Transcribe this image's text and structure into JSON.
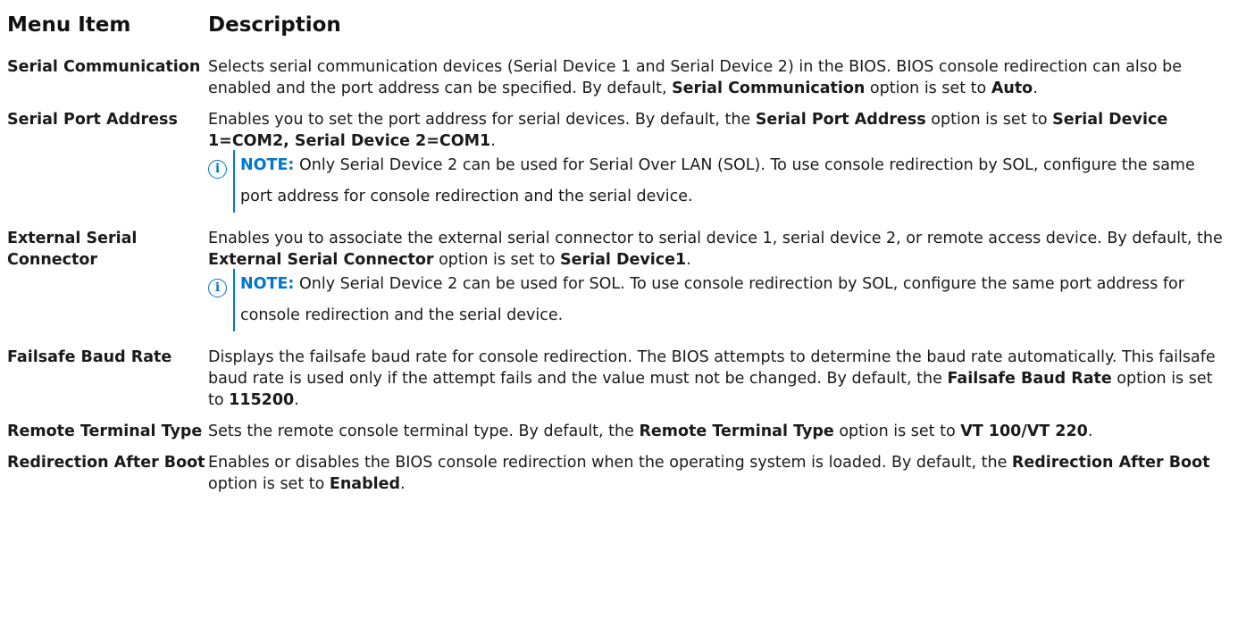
{
  "headers": {
    "item": "Menu Item",
    "description": "Description"
  },
  "rows": [
    {
      "item": "Serial Communication",
      "desc": [
        {
          "t": "Selects serial communication devices (Serial Device 1 and Serial Device 2) in the BIOS. BIOS console redirection can also be enabled and the port address can be specified. By default, "
        },
        {
          "t": "Serial Communication",
          "b": true
        },
        {
          "t": " option is set to "
        },
        {
          "t": "Auto",
          "b": true
        },
        {
          "t": "."
        }
      ]
    },
    {
      "item": "Serial Port Address",
      "desc": [
        {
          "t": "Enables you to set the port address for serial devices. By default, the "
        },
        {
          "t": "Serial Port Address",
          "b": true
        },
        {
          "t": " option is set to "
        },
        {
          "t": "Serial Device 1=COM2, Serial Device 2=COM1",
          "b": true
        },
        {
          "t": "."
        }
      ],
      "note": {
        "label": "NOTE:",
        "text": " Only Serial Device 2 can be used for Serial Over LAN (SOL). To use console redirection by SOL, configure the same port address for console redirection and the serial device."
      }
    },
    {
      "item": "External Serial Connector",
      "desc": [
        {
          "t": "Enables you to associate the external serial connector to serial device 1, serial device 2, or remote access device. By default, the "
        },
        {
          "t": "External Serial Connector",
          "b": true
        },
        {
          "t": " option is set to "
        },
        {
          "t": "Serial Device1",
          "b": true
        },
        {
          "t": "."
        }
      ],
      "note": {
        "label": "NOTE:",
        "text": " Only Serial Device 2 can be used for SOL. To use console redirection by SOL, configure the same port address for console redirection and the serial device."
      }
    },
    {
      "item": "Failsafe Baud Rate",
      "desc": [
        {
          "t": "Displays the failsafe baud rate for console redirection. The BIOS attempts to determine the baud rate automatically. This failsafe baud rate is used only if the attempt fails and the value must not be changed. By default, the "
        },
        {
          "t": "Failsafe Baud Rate",
          "b": true
        },
        {
          "t": " option is set to "
        },
        {
          "t": "115200",
          "b": true
        },
        {
          "t": "."
        }
      ]
    },
    {
      "item": "Remote Terminal Type",
      "desc": [
        {
          "t": "Sets the remote console terminal type. By default, the "
        },
        {
          "t": "Remote Terminal Type",
          "b": true
        },
        {
          "t": " option is set to "
        },
        {
          "t": "VT 100/VT 220",
          "b": true
        },
        {
          "t": "."
        }
      ]
    },
    {
      "item": "Redirection After Boot",
      "desc": [
        {
          "t": "Enables or disables the BIOS console redirection when the operating system is loaded. By default, the "
        },
        {
          "t": "Redirection After Boot",
          "b": true
        },
        {
          "t": " option is set to "
        },
        {
          "t": "Enabled",
          "b": true
        },
        {
          "t": "."
        }
      ]
    }
  ],
  "note_icon": "info-icon",
  "accent_color": "#0076ce"
}
